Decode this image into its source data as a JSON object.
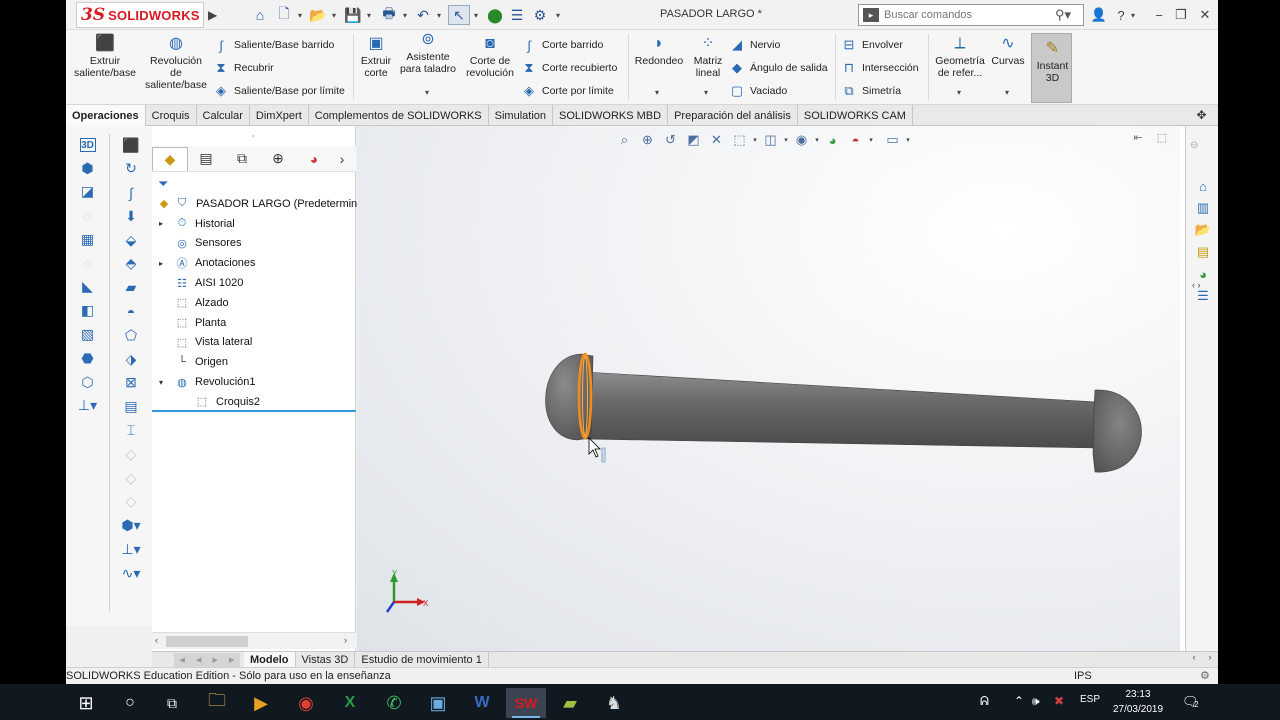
{
  "window": {
    "app_name": "SOLIDWORKS",
    "document_title": "PASADOR LARGO *",
    "search_placeholder": "Buscar comandos"
  },
  "ribbon": {
    "extrude_boss": "Extruir saliente/base",
    "revolve_boss_l1": "Revolución",
    "revolve_boss_l2": "de",
    "revolve_boss_l3": "saliente/base",
    "swept_boss": "Saliente/Base barrido",
    "lofted_boss": "Recubrir",
    "boundary_boss": "Saliente/Base por límite",
    "extrude_cut_l1": "Extruir",
    "extrude_cut_l2": "corte",
    "hole_wizard_l1": "Asistente",
    "hole_wizard_l2": "para taladro",
    "revolve_cut_l1": "Corte de",
    "revolve_cut_l2": "revolución",
    "swept_cut": "Corte barrido",
    "lofted_cut": "Corte recubierto",
    "boundary_cut": "Corte por límite",
    "fillet": "Redondeo",
    "linear_pattern_l1": "Matriz",
    "linear_pattern_l2": "lineal",
    "rib": "Nervio",
    "draft": "Ángulo de salida",
    "shell": "Vaciado",
    "wrap": "Envolver",
    "intersect": "Intersección",
    "mirror": "Simetría",
    "ref_geometry_l1": "Geometría",
    "ref_geometry_l2": "de refer...",
    "curves": "Curvas",
    "instant3d_l1": "Instant",
    "instant3d_l2": "3D"
  },
  "tabs": [
    "Operaciones",
    "Croquis",
    "Calcular",
    "DimXpert",
    "Complementos de SOLIDWORKS",
    "Simulation",
    "SOLIDWORKS MBD",
    "Preparación del análisis",
    "SOLIDWORKS CAM"
  ],
  "tree": {
    "root": "PASADOR LARGO  (Predetermina",
    "items": [
      "Historial",
      "Sensores",
      "Anotaciones",
      "AISI 1020",
      "Alzado",
      "Planta",
      "Vista lateral",
      "Origen",
      "Revolución1",
      "Croquis2"
    ]
  },
  "triad": {
    "x": "X",
    "y": "Y"
  },
  "model_tabs": [
    "Modelo",
    "Vistas 3D",
    "Estudio de movimiento 1"
  ],
  "status": {
    "edition": "SOLIDWORKS Education Edition - Sólo para uso en la enseñanza",
    "units": "IPS"
  },
  "taskbar": {
    "lang": "ESP",
    "time": "23:13",
    "date": "27/03/2019",
    "notifications": "2"
  },
  "colors": {
    "brand": "#d71920",
    "accent": "#2a6bb3",
    "selection": "#f28c1a",
    "part": "#6e6e6e"
  }
}
